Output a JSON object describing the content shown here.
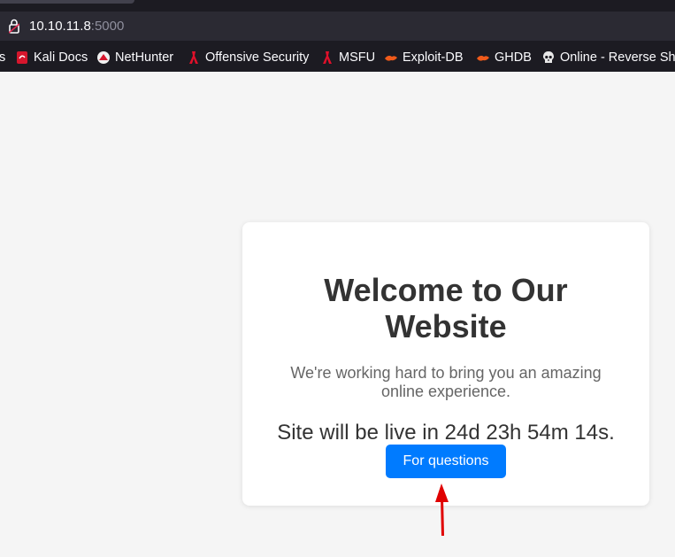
{
  "browser": {
    "url_host": "10.10.11.8",
    "url_port": ":5000",
    "bookmarks": [
      {
        "label": "s",
        "icon": "kali-tools-icon"
      },
      {
        "label": "Kali Docs",
        "icon": "kali-docs-icon"
      },
      {
        "label": "NetHunter",
        "icon": "nethunter-icon"
      },
      {
        "label": "Offensive Security",
        "icon": "offsec-icon"
      },
      {
        "label": "MSFU",
        "icon": "msfu-icon"
      },
      {
        "label": "Exploit-DB",
        "icon": "exploit-db-icon"
      },
      {
        "label": "GHDB",
        "icon": "ghdb-icon"
      },
      {
        "label": "Online - Reverse Sh",
        "icon": "skull-icon"
      }
    ]
  },
  "card": {
    "title": "Welcome to Our Website",
    "text": "We're working hard to bring you an amazing online experience.",
    "countdown": "Site will be live in 24d 23h 54m 14s.",
    "button_label": "For questions"
  },
  "annotation": {
    "icon": "red-arrow-icon",
    "color": "#e00000"
  }
}
